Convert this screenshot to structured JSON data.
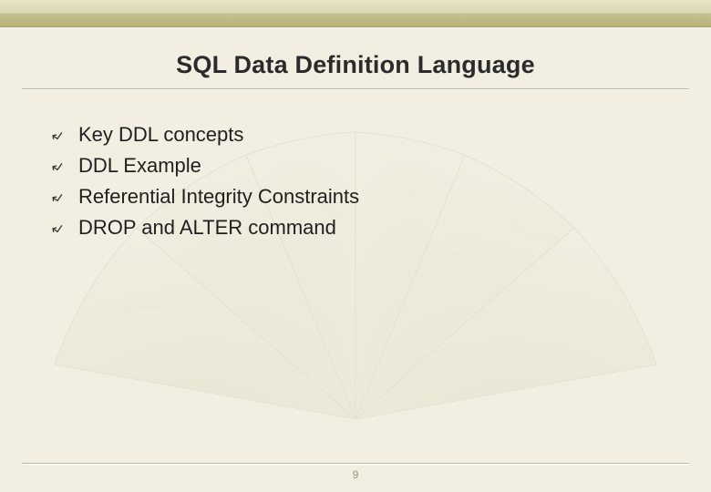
{
  "title": "SQL Data Definition Language",
  "bullets": [
    {
      "label": "Key DDL concepts"
    },
    {
      "label": "DDL Example"
    },
    {
      "label": "Referential Integrity Constraints"
    },
    {
      "label": "DROP and ALTER command"
    }
  ],
  "bullet_glyph": "↲",
  "page_number": "9"
}
